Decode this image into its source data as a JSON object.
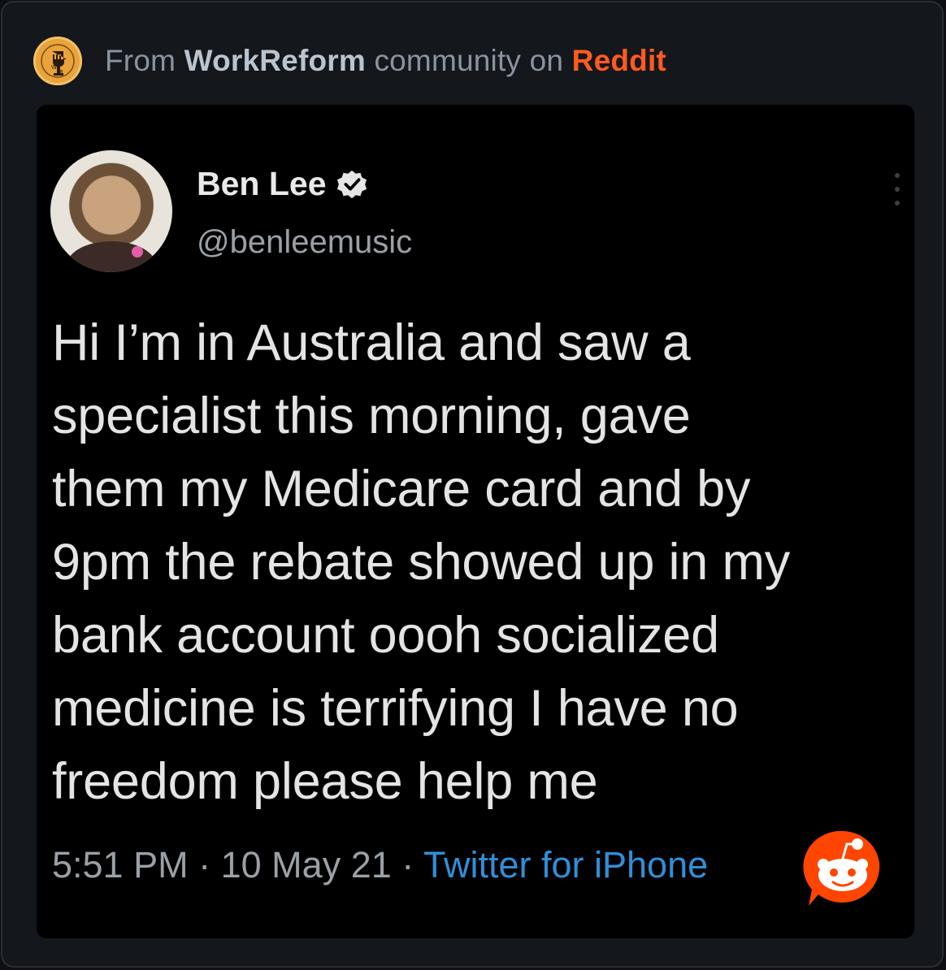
{
  "header": {
    "prefix": "From",
    "community": "WorkReform",
    "middle": "community on",
    "platform": "Reddit",
    "community_icon": "workreform-fist-icon",
    "colors": {
      "platform": "#ff5a1f",
      "community_icon_bg": "#e8a33a"
    }
  },
  "tweet": {
    "author_name": "Ben Lee",
    "author_handle": "@benleemusic",
    "verified_icon": "verified-badge-icon",
    "body_lines": [
      "Hi I’m in Australia and saw a",
      "specialist this morning, gave",
      "them my Medicare card and by",
      "9pm the rebate showed up in my",
      "bank account oooh socialized",
      "medicine is terrifying I have no",
      "freedom please help me"
    ],
    "time": "5:51 PM",
    "date": "10 May 21",
    "separator": "·",
    "client": "Twitter for iPhone",
    "colors": {
      "client_link": "#2f8fd8"
    }
  },
  "watermark": {
    "icon": "reddit-snoo-icon",
    "color": "#ff4500"
  }
}
